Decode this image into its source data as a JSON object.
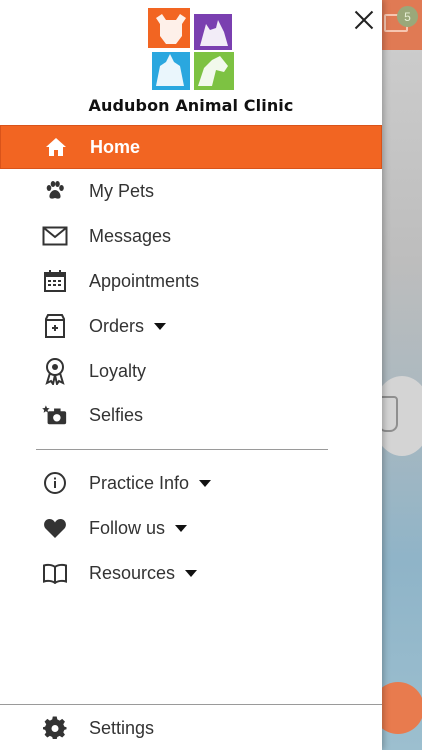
{
  "background": {
    "badge_count": "5"
  },
  "drawer": {
    "clinic_name": "Audubon Animal Clinic",
    "logo_colors": [
      "#f26522",
      "#7a3fb0",
      "#2aa7df",
      "#7dc242"
    ],
    "accent_color": "#f26522",
    "items": [
      {
        "label": "Home",
        "icon": "home-icon",
        "active": true
      },
      {
        "label": "My Pets",
        "icon": "paw-icon"
      },
      {
        "label": "Messages",
        "icon": "mail-icon"
      },
      {
        "label": "Appointments",
        "icon": "calendar-icon"
      },
      {
        "label": "Orders",
        "icon": "pet-food-bag-icon",
        "dropdown": true
      },
      {
        "label": "Loyalty",
        "icon": "award-ribbon-icon"
      },
      {
        "label": "Selfies",
        "icon": "camera-star-icon"
      }
    ],
    "secondary_items": [
      {
        "label": "Practice Info",
        "icon": "info-icon",
        "dropdown": true
      },
      {
        "label": "Follow us",
        "icon": "heart-icon",
        "dropdown": true
      },
      {
        "label": "Resources",
        "icon": "book-icon",
        "dropdown": true
      }
    ],
    "footer": {
      "label": "Settings",
      "icon": "gear-icon"
    }
  }
}
